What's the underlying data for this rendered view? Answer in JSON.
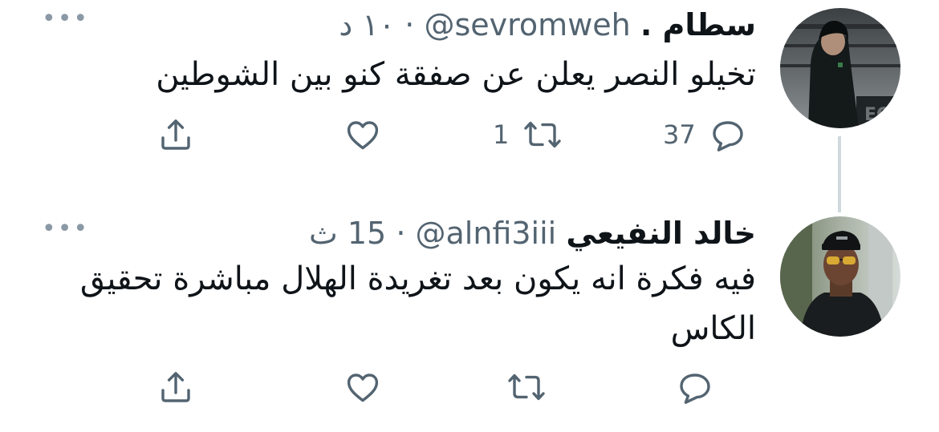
{
  "tweets": [
    {
      "display_name": "سطام .",
      "handle": "@sevromweh",
      "separator": "·",
      "time": "١٠ د",
      "more": "•••",
      "text": "تخيلو النصر يعلن عن صفقة كنو بين الشوطين",
      "reply_count": "37",
      "retweet_count": "1",
      "like_count": ""
    },
    {
      "display_name": "خالد النفيعي",
      "handle": "@alnfi3iii",
      "separator": "·",
      "time": "15 ث",
      "more": "•••",
      "text": "فيه فكرة انه يكون بعد تغريدة الهلال مباشرة تحقيق الكاس",
      "reply_count": "",
      "retweet_count": "",
      "like_count": ""
    }
  ],
  "icons": {
    "reply": "reply-icon",
    "retweet": "retweet-icon",
    "like": "like-icon",
    "share": "share-icon",
    "more": "more-icon"
  },
  "colors": {
    "text": "#0f1419",
    "secondary": "#536471",
    "thread_line": "#cfd9de"
  }
}
